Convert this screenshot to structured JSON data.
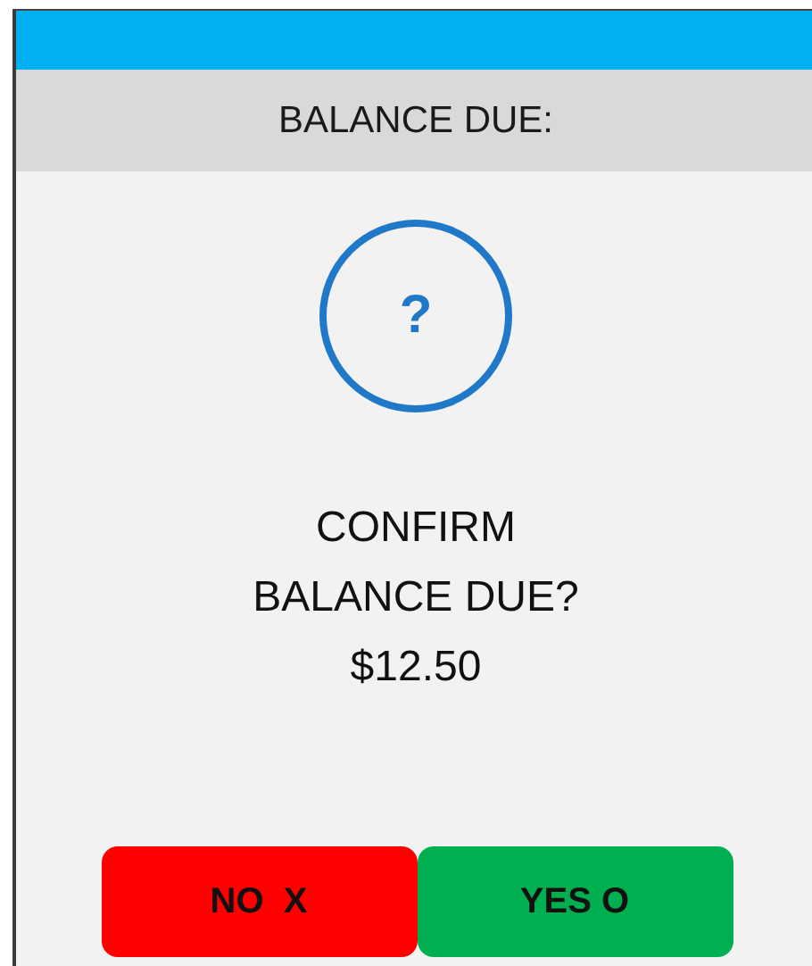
{
  "header": {
    "title": "BALANCE DUE:"
  },
  "dialog": {
    "icon": "?",
    "message_lines": [
      "CONFIRM",
      "BALANCE DUE?",
      "$12.50"
    ]
  },
  "buttons": [
    {
      "label": "NO  X",
      "kind": "cancel"
    },
    {
      "label": "YES O",
      "kind": "confirm"
    }
  ]
}
